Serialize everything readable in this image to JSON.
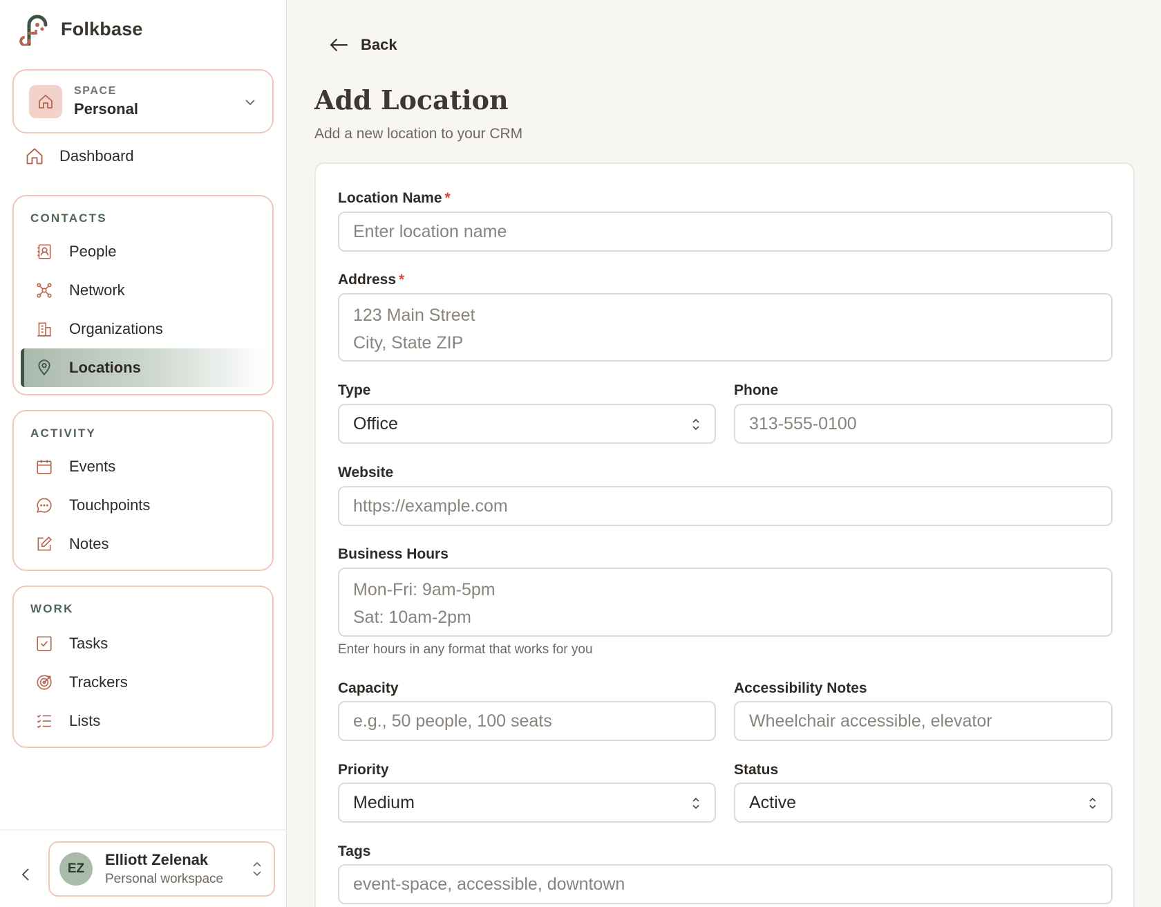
{
  "brand": {
    "name": "Folkbase"
  },
  "space": {
    "caption": "SPACE",
    "value": "Personal"
  },
  "nav": {
    "dashboard": "Dashboard",
    "contacts": {
      "title": "CONTACTS",
      "items": [
        "People",
        "Network",
        "Organizations",
        "Locations"
      ]
    },
    "activity": {
      "title": "ACTIVITY",
      "items": [
        "Events",
        "Touchpoints",
        "Notes"
      ]
    },
    "work": {
      "title": "WORK",
      "items": [
        "Tasks",
        "Trackers",
        "Lists"
      ]
    },
    "active_item": "Locations"
  },
  "user": {
    "initials": "EZ",
    "name": "Elliott Zelenak",
    "workspace": "Personal workspace"
  },
  "header": {
    "back_label": "Back",
    "title": "Add Location",
    "subtitle": "Add a new location to your CRM"
  },
  "form": {
    "location_name": {
      "label": "Location Name",
      "required": "*",
      "placeholder": "Enter location name"
    },
    "address": {
      "label": "Address",
      "required": "*",
      "placeholder_line1": "123 Main Street",
      "placeholder_line2": "City, State ZIP"
    },
    "type": {
      "label": "Type",
      "value": "Office"
    },
    "phone": {
      "label": "Phone",
      "placeholder": "313-555-0100"
    },
    "website": {
      "label": "Website",
      "placeholder": "https://example.com"
    },
    "business_hours": {
      "label": "Business Hours",
      "placeholder_line1": "Mon-Fri: 9am-5pm",
      "placeholder_line2": "Sat: 10am-2pm",
      "hint": "Enter hours in any format that works for you"
    },
    "capacity": {
      "label": "Capacity",
      "placeholder": "e.g., 50 people, 100 seats"
    },
    "accessibility": {
      "label": "Accessibility Notes",
      "placeholder": "Wheelchair accessible, elevator"
    },
    "priority": {
      "label": "Priority",
      "value": "Medium"
    },
    "status": {
      "label": "Status",
      "value": "Active"
    },
    "tags": {
      "label": "Tags",
      "placeholder": "event-space, accessible, downtown"
    }
  },
  "colors": {
    "accent_green": "#3e5546",
    "icon_terracotta": "#b5654f",
    "card_border": "#f2c6bd",
    "required": "#d24a3c"
  }
}
